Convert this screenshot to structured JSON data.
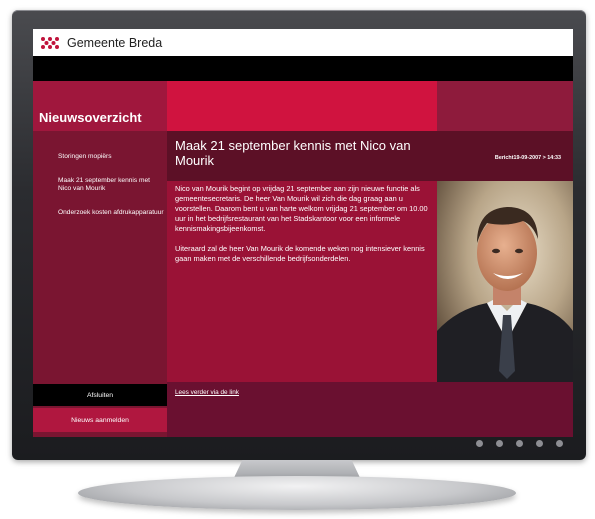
{
  "header": {
    "title": "Gemeente Breda",
    "logo_icon": "breda-coat-of-arms-icon"
  },
  "sidebar": {
    "heading": "Nieuwsoverzicht",
    "items": [
      {
        "label": "Storingen mopiërs"
      },
      {
        "label": "Maak 21 september kennis met Nico van Mourik"
      },
      {
        "label": "Onderzoek kosten afdrukapparatuur"
      }
    ],
    "afsluiten_label": "Afsluiten",
    "nieuws_label": "Nieuws aanmelden"
  },
  "article": {
    "title": "Maak 21 september kennis met Nico van Mourik",
    "bericht": "Bericht19-09-2007 > 14:33",
    "paragraphs": [
      "Nico van Mourik begint op vrijdag 21 september aan zijn nieuwe functie als gemeentesecretaris. De heer Van Mourik wil zich die dag graag aan u voorstellen. Daarom bent u van harte welkom vrijdag 21 september om 10.00 uur in het bedrijfsrestaurant van het Stadskantoor voor een informele kennismakingsbijeenkomst.",
      "Uiteraard zal de heer Van Mourik de komende weken nog intensiever kennis gaan maken met de verschillende bedrijfsonderdelen."
    ],
    "link_label": "Lees verder via de link"
  },
  "colors": {
    "crimson": "#d0133f",
    "wine": "#7a1531",
    "dark_wine": "#5c1026",
    "body": "#9a1236"
  }
}
